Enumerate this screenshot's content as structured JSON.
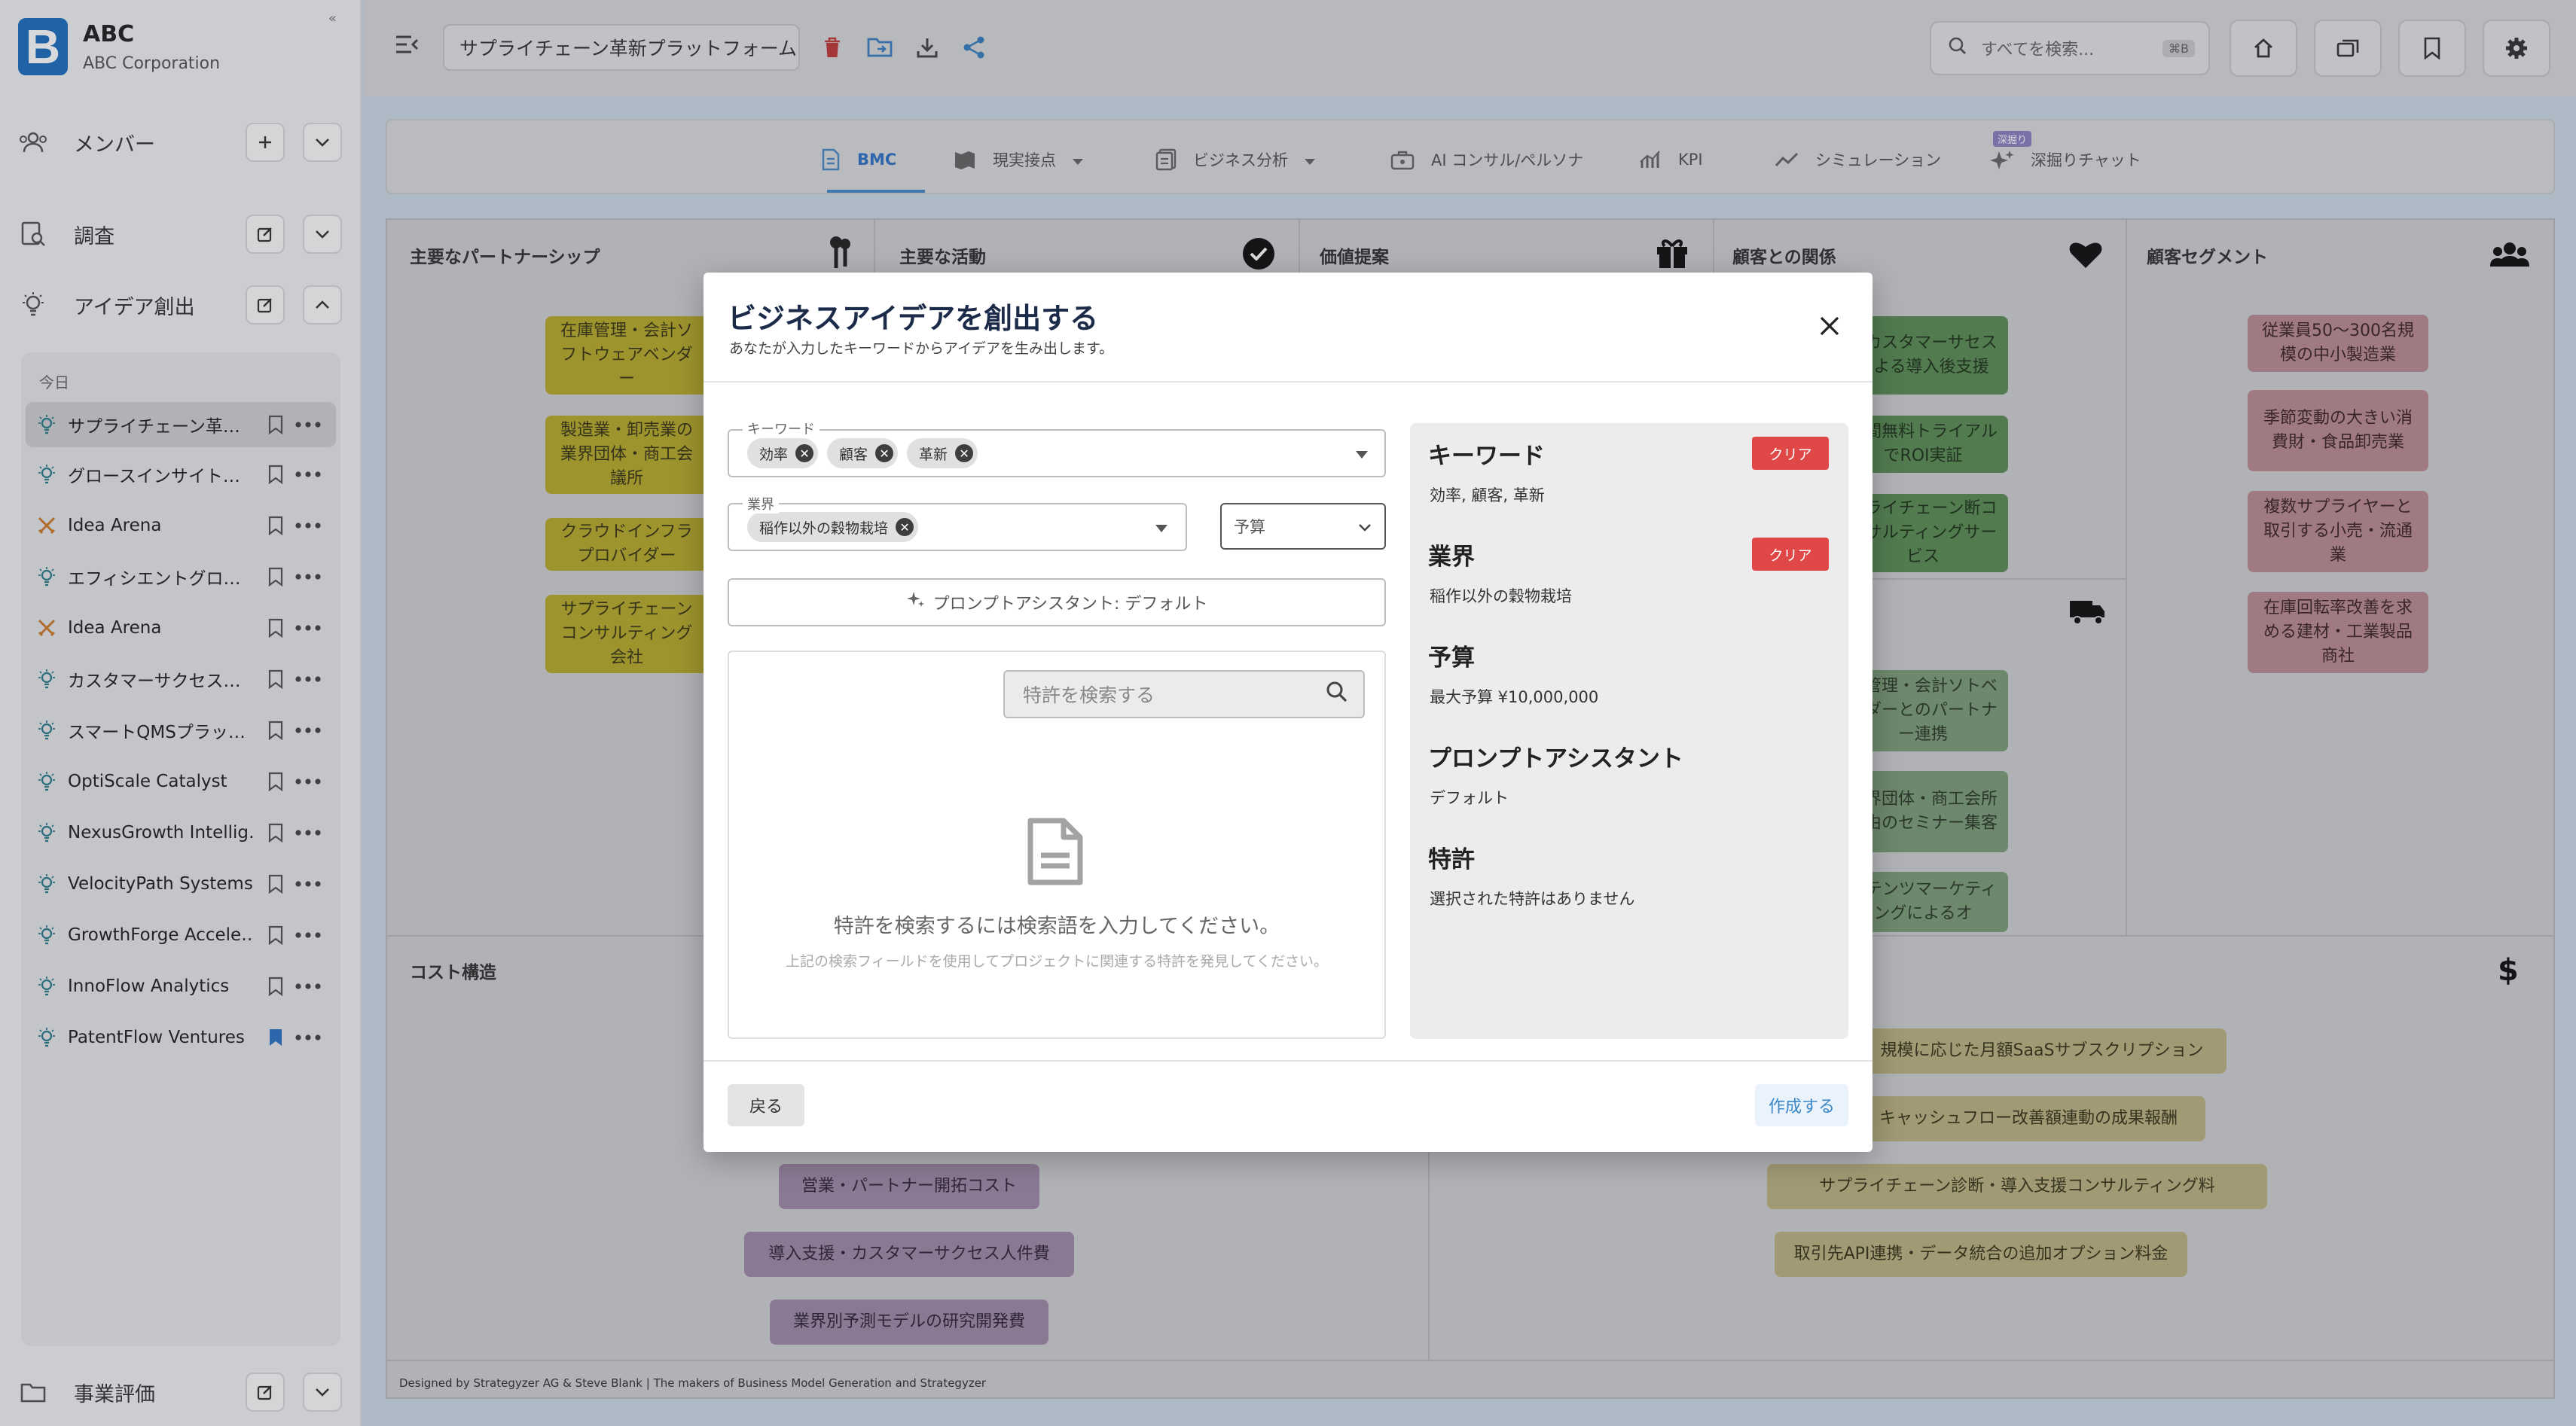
{
  "app": {
    "brand": "ABC",
    "brand_sub": "ABC Corporation",
    "logo_letter": "B"
  },
  "sidebar": {
    "sections": [
      {
        "label": "メンバー",
        "icon": "members-icon"
      },
      {
        "label": "調査",
        "icon": "research-icon"
      },
      {
        "label": "アイデア創出",
        "icon": "lightbulb-icon"
      }
    ],
    "today_label": "今日",
    "history": [
      {
        "label": "サプライチェーン革…",
        "icon": "lightbulb-icon",
        "active": true
      },
      {
        "label": "グロースインサイト…",
        "icon": "lightbulb-icon"
      },
      {
        "label": "Idea Arena",
        "icon": "swords-icon"
      },
      {
        "label": "エフィシエントグロ…",
        "icon": "lightbulb-icon"
      },
      {
        "label": "Idea Arena",
        "icon": "swords-icon"
      },
      {
        "label": "カスタマーサクセス…",
        "icon": "lightbulb-icon"
      },
      {
        "label": "スマートQMSプラッ…",
        "icon": "lightbulb-icon"
      },
      {
        "label": "OptiScale Catalyst",
        "icon": "lightbulb-icon"
      },
      {
        "label": "NexusGrowth Intellig…",
        "icon": "lightbulb-icon"
      },
      {
        "label": "VelocityPath Systems",
        "icon": "lightbulb-icon"
      },
      {
        "label": "GrowthForge Accele…",
        "icon": "lightbulb-icon"
      },
      {
        "label": "InnoFlow Analytics",
        "icon": "lightbulb-icon"
      },
      {
        "label": "PatentFlow Ventures",
        "icon": "lightbulb-icon",
        "bookmarked": true
      }
    ],
    "bottom_section": {
      "label": "事業評価",
      "icon": "folder-icon"
    }
  },
  "topbar": {
    "project_title": "サプライチェーン革新プラットフォーム",
    "search_placeholder": "すべてを検索...",
    "search_shortcut": "⌘B"
  },
  "tabs": [
    {
      "label": "BMC",
      "active": true
    },
    {
      "label": "現実接点",
      "dropdown": true
    },
    {
      "label": "ビジネス分析",
      "dropdown": true
    },
    {
      "label": "AI コンサル/ペルソナ"
    },
    {
      "label": "KPI"
    },
    {
      "label": "シミュレーション"
    },
    {
      "label": "深掘りチャット",
      "badge": "深掘り"
    }
  ],
  "bmc": {
    "partners_title": "主要なパートナーシップ",
    "activities_title": "主要な活動",
    "value_title": "価値提案",
    "relations_title": "顧客との関係",
    "segments_title": "顧客セグメント",
    "cost_title": "コスト構造",
    "partners": [
      "在庫管理・会計ソフトウェアベンダー",
      "製造業・卸売業の業界団体・商工会議所",
      "クラウドインフラプロバイダー",
      "サプライチェーンコンサルティング会社"
    ],
    "relations": [
      "任カスタマーサセスによる導入後支援",
      "日間無料トライアルでROI実証",
      "プライチェーン断コンサルティングサービス"
    ],
    "channels": [
      "庫管理・会計ソトベンダーとのパートナー連携",
      "業界団体・商工会所経由のセミナー集客",
      "ンテンツマーケティングによるオ"
    ],
    "segments": [
      "従業員50〜300名規模の中小製造業",
      "季節変動の大きい消費財・食品卸売業",
      "複数サプライヤーと取引する小売・流通業",
      "在庫回転率改善を求める建材・工業製品商社"
    ],
    "costs": [
      "営業・パートナー開拓コスト",
      "導入支援・カスタマーサクセス人件費",
      "業界別予測モデルの研究開発費"
    ],
    "revenue": [
      "規模に応じた月額SaaSサブスクリプション",
      "キャッシュフロー改善額連動の成果報酬",
      "サプライチェーン診断・導入支援コンサルティング料",
      "取引先API連携・データ統合の追加オプション料金"
    ],
    "credit": "Designed by Strategyzer AG & Steve Blank | The makers of Business Model Generation and Strategyzer"
  },
  "modal": {
    "title": "ビジネスアイデアを創出する",
    "subtitle": "あなたが入力したキーワードからアイデアを生み出します。",
    "keyword_legend": "キーワード",
    "keywords": [
      "効率",
      "顧客",
      "革新"
    ],
    "industry_legend": "業界",
    "industries": [
      "稲作以外の穀物栽培"
    ],
    "budget_placeholder": "予算",
    "prompt_button": "プロンプトアシスタント: デフォルト",
    "patent_search_placeholder": "特許を検索する",
    "empty_title": "特許を検索するには検索語を入力してください。",
    "empty_hint": "上記の検索フィールドを使用してプロジェクトに関連する特許を発見してください。",
    "summary": {
      "keyword_h": "キーワード",
      "keyword_v": "効率, 顧客, 革新",
      "industry_h": "業界",
      "industry_v": "稲作以外の穀物栽培",
      "budget_h": "予算",
      "budget_v": "最大予算 ¥10,000,000",
      "prompt_h": "プロンプトアシスタント",
      "prompt_v": "デフォルト",
      "patent_h": "特許",
      "patent_v": "選択された特許はありません",
      "clear_label": "クリア"
    },
    "back_label": "戻る",
    "create_label": "作成する"
  },
  "colors": {
    "accent": "#1e6fc0",
    "danger": "#e04848",
    "sticky_yellow": "#b8ab2e",
    "sticky_green": "#5c8d57",
    "sticky_pink": "#bb8b95"
  }
}
